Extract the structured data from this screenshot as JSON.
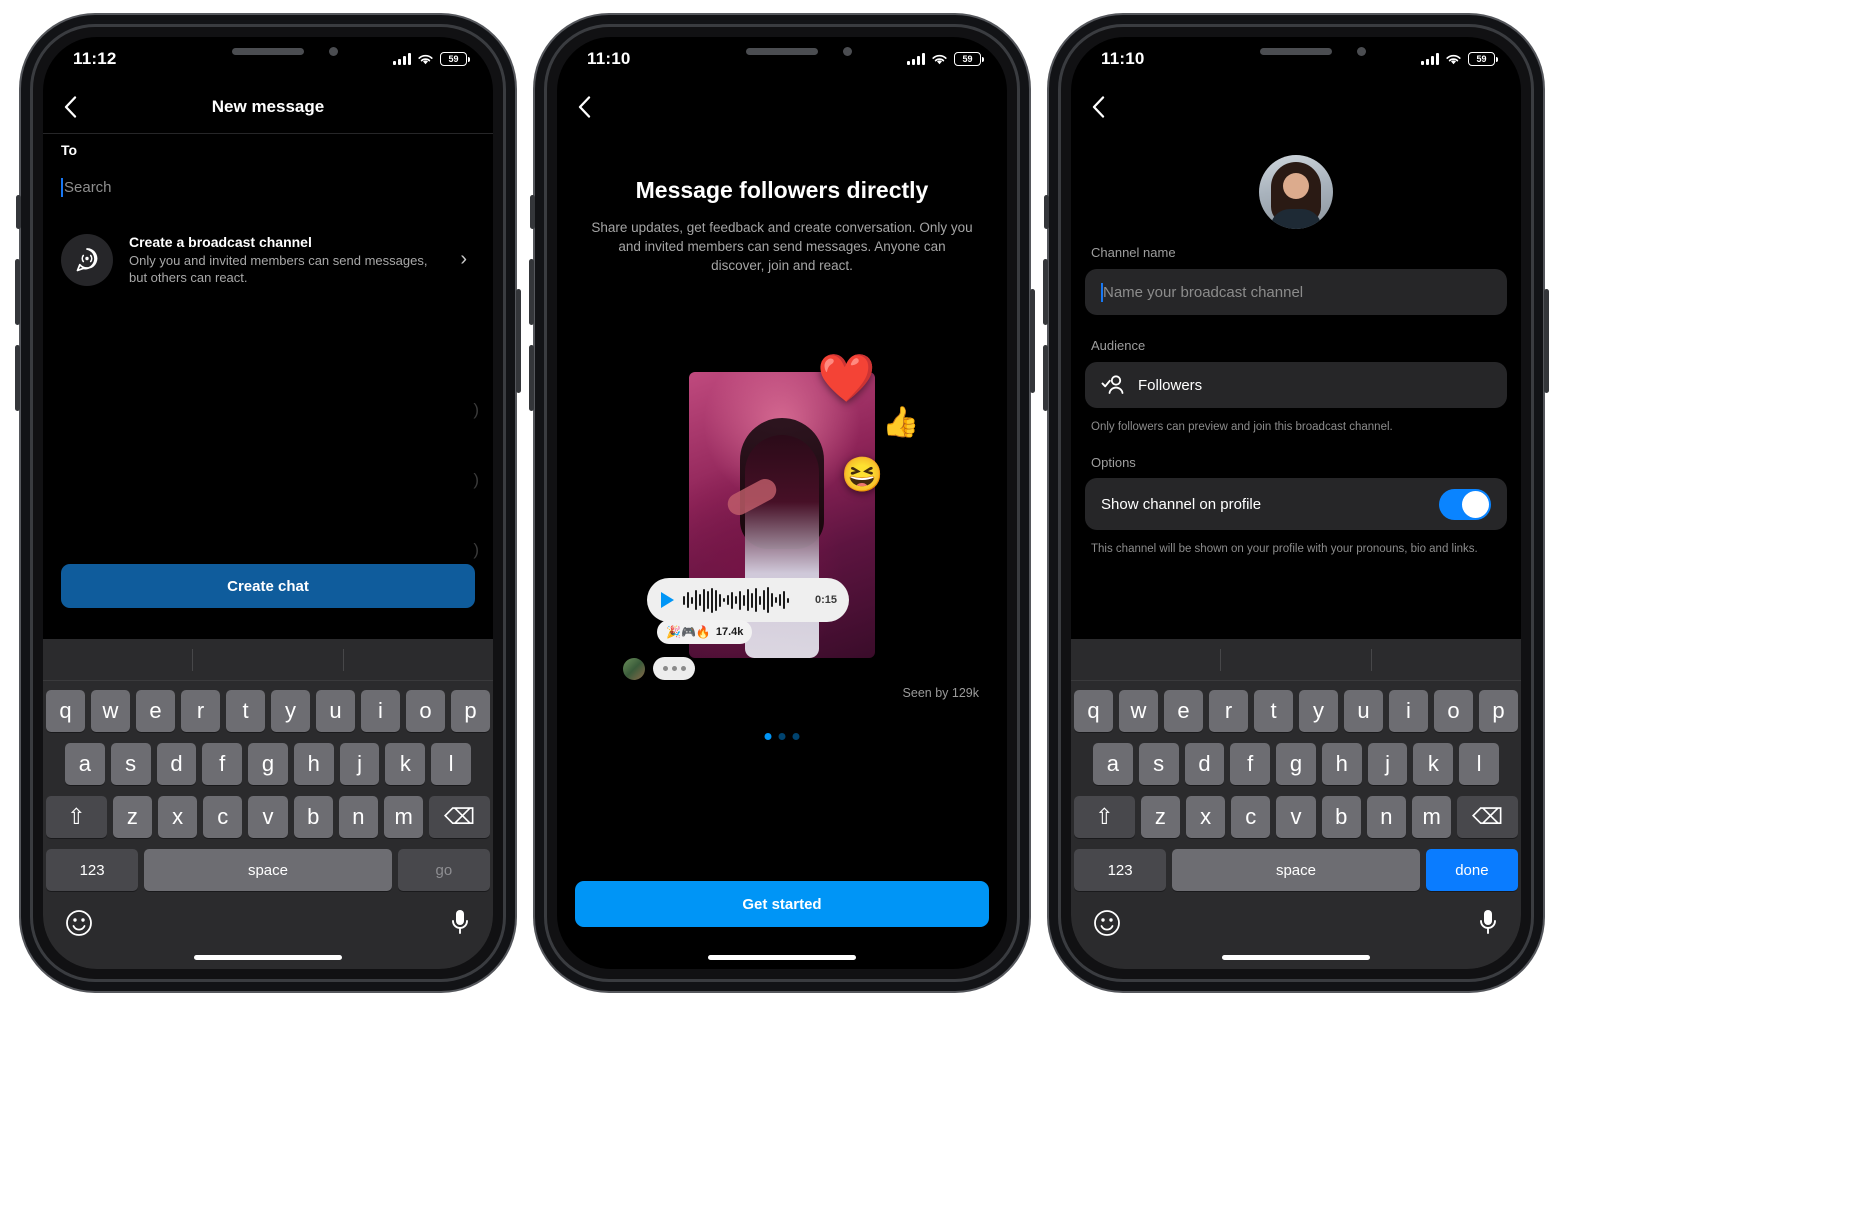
{
  "phone1": {
    "status": {
      "time": "11:12",
      "battery": "59"
    },
    "nav": {
      "title": "New message",
      "back_icon": "chevron-left-icon"
    },
    "to_label": "To",
    "search": {
      "placeholder": "Search",
      "value": ""
    },
    "broadcast_card": {
      "title": "Create a broadcast channel",
      "subtitle": "Only you and invited members can send messages, but others can react.",
      "icon": "broadcast-channel-icon",
      "chevron": "›"
    },
    "ghost_marks": [
      ")",
      ")",
      ")"
    ],
    "cta": {
      "label": "Create chat",
      "color": "#0f5c9c"
    },
    "keyboard": {
      "row1": [
        "q",
        "w",
        "e",
        "r",
        "t",
        "y",
        "u",
        "i",
        "o",
        "p"
      ],
      "row2": [
        "a",
        "s",
        "d",
        "f",
        "g",
        "h",
        "j",
        "k",
        "l"
      ],
      "row3": [
        "z",
        "x",
        "c",
        "v",
        "b",
        "n",
        "m"
      ],
      "shift": "⇧",
      "backspace": "⌫",
      "numbers": "123",
      "space": "space",
      "action": "go",
      "emoji_icon": "emoji-icon",
      "mic_icon": "microphone-icon"
    }
  },
  "phone2": {
    "status": {
      "time": "11:10",
      "battery": "59"
    },
    "nav": {
      "back_icon": "chevron-left-icon"
    },
    "title": "Message followers directly",
    "description": "Share updates, get feedback and create conversation. Only you and invited members can send messages. Anyone can discover, join and react.",
    "reactions": [
      "❤️",
      "👍",
      "😆"
    ],
    "audio": {
      "duration": "0:15",
      "play_icon": "play-icon"
    },
    "reaction_pill": {
      "emojis": "🎉🎮🔥",
      "count": "17.4k"
    },
    "seen_by": "Seen by 129k",
    "page_dots": {
      "total": 3,
      "active": 0
    },
    "cta": {
      "label": "Get started",
      "color": "#0095f6"
    }
  },
  "phone3": {
    "status": {
      "time": "11:10",
      "battery": "59"
    },
    "nav": {
      "back_icon": "chevron-left-icon"
    },
    "avatar": "profile-avatar",
    "channel_name": {
      "label": "Channel name",
      "placeholder": "Name your broadcast channel",
      "value": ""
    },
    "audience": {
      "label": "Audience",
      "value": "Followers",
      "icon": "followers-icon",
      "helper": "Only followers can preview and join this broadcast channel."
    },
    "options": {
      "label": "Options",
      "toggle_label": "Show channel on profile",
      "toggle_on": true,
      "toggle_color": "#0a84ff",
      "helper": "This channel will be shown on your profile with your pronouns, bio and links."
    },
    "keyboard": {
      "row1": [
        "q",
        "w",
        "e",
        "r",
        "t",
        "y",
        "u",
        "i",
        "o",
        "p"
      ],
      "row2": [
        "a",
        "s",
        "d",
        "f",
        "g",
        "h",
        "j",
        "k",
        "l"
      ],
      "row3": [
        "z",
        "x",
        "c",
        "v",
        "b",
        "n",
        "m"
      ],
      "shift": "⇧",
      "backspace": "⌫",
      "numbers": "123",
      "space": "space",
      "action": "done",
      "emoji_icon": "emoji-icon",
      "mic_icon": "microphone-icon"
    }
  }
}
